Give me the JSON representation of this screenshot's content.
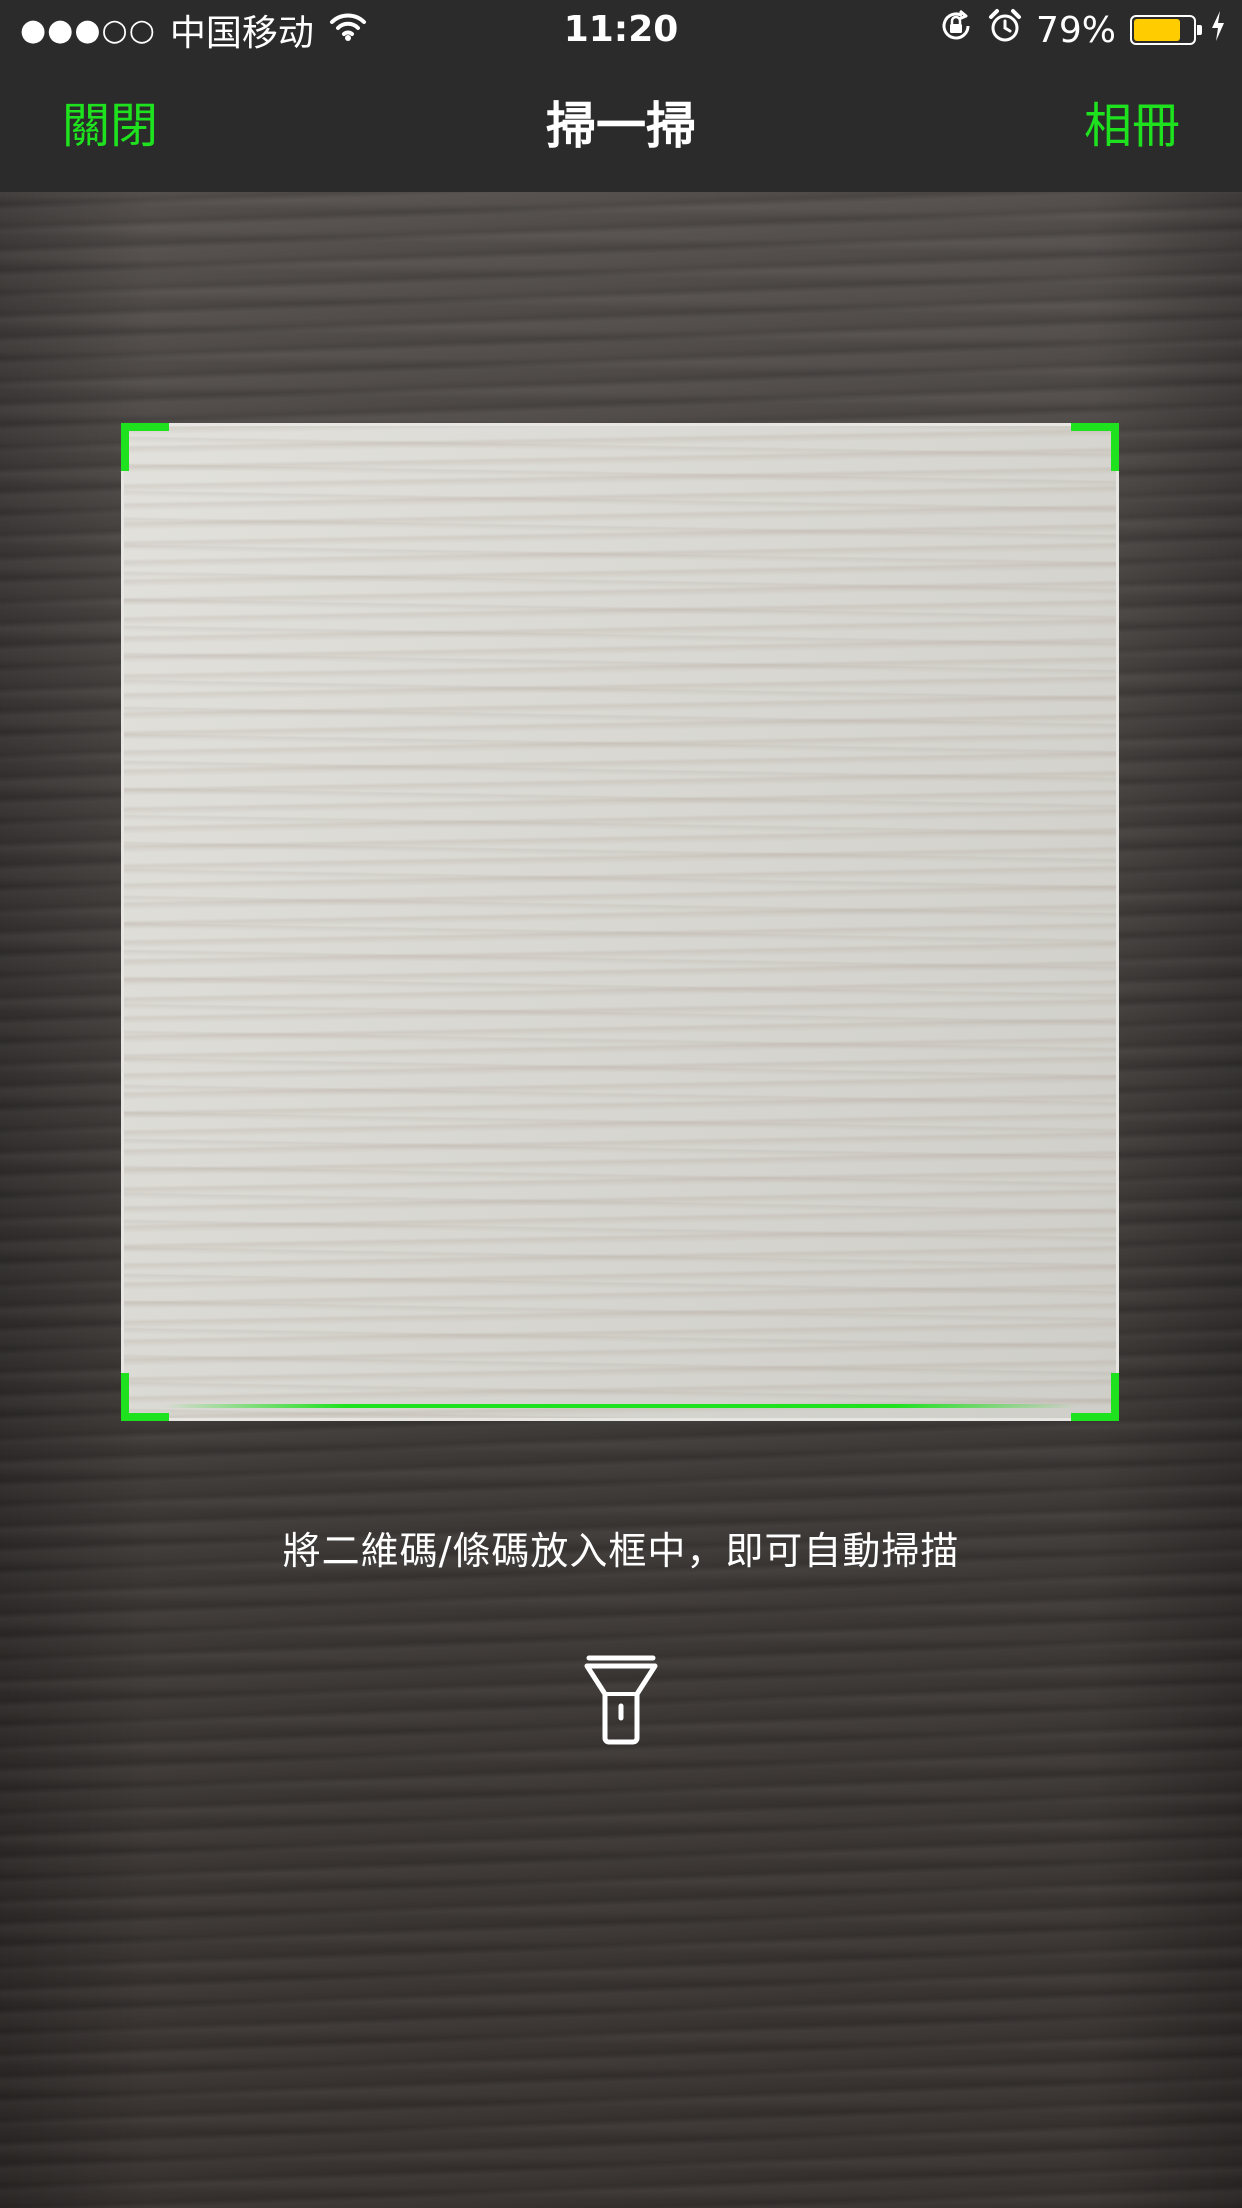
{
  "status_bar": {
    "signal": "●●●○○",
    "carrier": "中国移动",
    "time": "11:20",
    "battery_percent": "79%",
    "battery_level": 0.79,
    "icons": [
      "wifi-icon",
      "orientation-lock-icon",
      "alarm-icon",
      "battery-icon",
      "charging-icon"
    ]
  },
  "nav": {
    "close_label": "關閉",
    "title": "掃一掃",
    "album_label": "相冊"
  },
  "scanner": {
    "hint": "將二維碼/條碼放入框中，即可自動掃描",
    "flashlight_icon": "flashlight-icon"
  },
  "colors": {
    "accent": "#1ee21e",
    "bar_background": "#2b2b2b",
    "battery_fill": "#ffcc00"
  }
}
